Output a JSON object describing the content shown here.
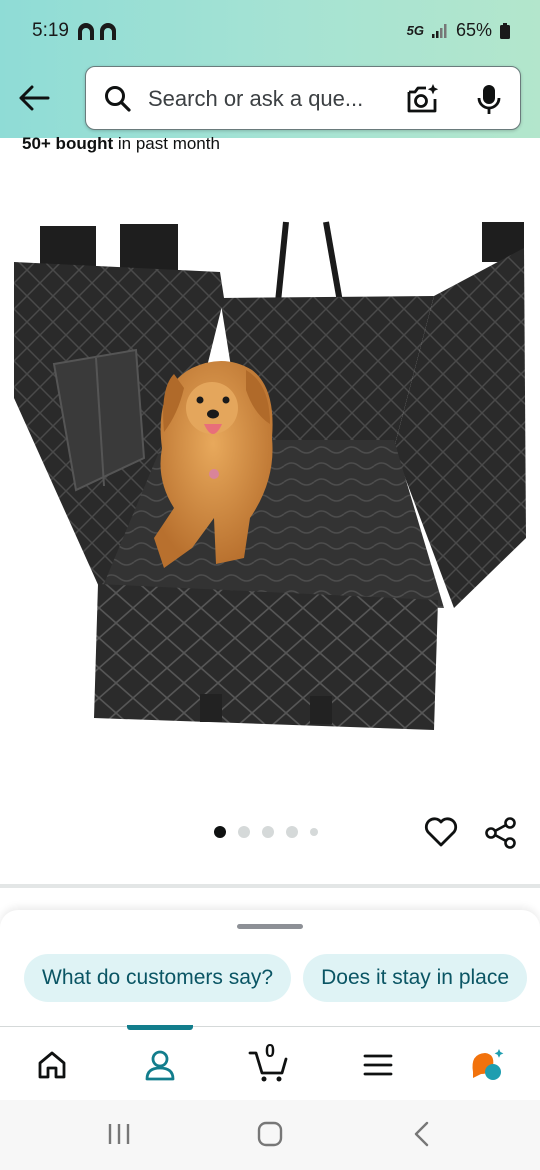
{
  "status_bar": {
    "time": "5:19",
    "network": "5G",
    "battery": "65%"
  },
  "search": {
    "placeholder": "Search or ask a que..."
  },
  "product": {
    "bought_count": "50+ bought",
    "bought_suffix": " in past month",
    "image_alt": "Black quilted dog car seat cover with golden retriever",
    "image_count": 5,
    "active_image_index": 0
  },
  "sheet": {
    "chips": [
      {
        "label": "What do customers say?"
      },
      {
        "label": "Does it stay in place"
      }
    ]
  },
  "bottom_nav": {
    "items": [
      "home",
      "account",
      "cart",
      "menu",
      "rufus"
    ],
    "active": "account",
    "cart_count": "0"
  },
  "colors": {
    "header_bg": "#a6e3d3",
    "accent": "#127d8c",
    "chip_bg": "#dff3f5",
    "chip_text": "#0a5564"
  }
}
